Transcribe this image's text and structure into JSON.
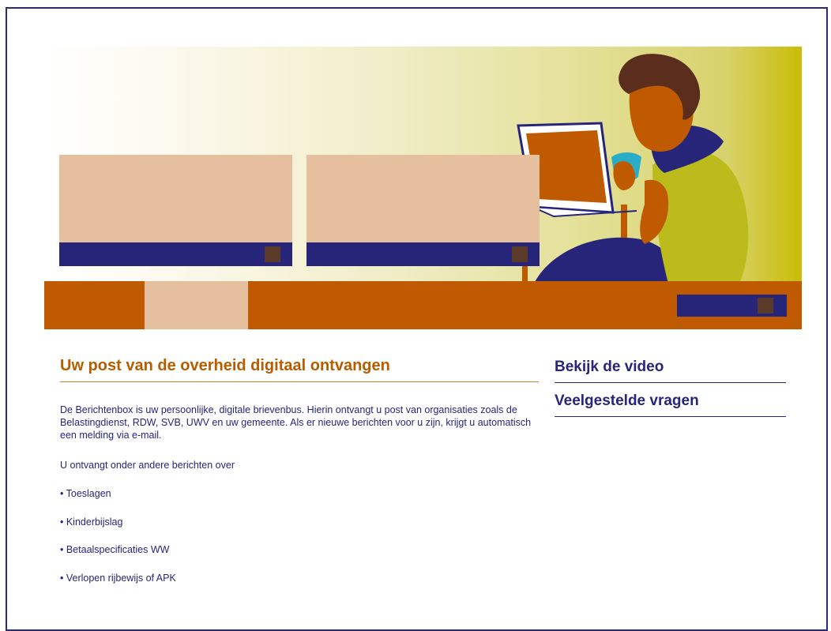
{
  "colors": {
    "navy": "#26257a",
    "orange": "#c05a00",
    "peach": "#e6bf9f",
    "title_orange": "#b65d00",
    "mustard": "#c9bd08",
    "brown_square": "#5c3a2a"
  },
  "hero": {
    "illustration": "person-with-laptop-and-cup-illustration"
  },
  "main": {
    "title": "Uw post van de overheid digitaal ontvangen",
    "intro": "De Berichtenbox is uw persoonlijke, digitale brievenbus. Hierin ontvangt u post van organisaties zoals de Belastingdienst, RDW, SVB, UWV en uw gemeente. Als er nieuwe berichten voor u zijn, krijgt u automatisch een melding via e-mail.",
    "subintro": "U ontvangt onder andere berichten over",
    "bullets": [
      "• Toeslagen",
      "• Kinderbijslag",
      "• Betaalspecificaties WW",
      "• Verlopen rijbewijs of APK"
    ]
  },
  "sidebar": {
    "links": [
      "Bekijk de video",
      "Veelgestelde vragen"
    ]
  }
}
